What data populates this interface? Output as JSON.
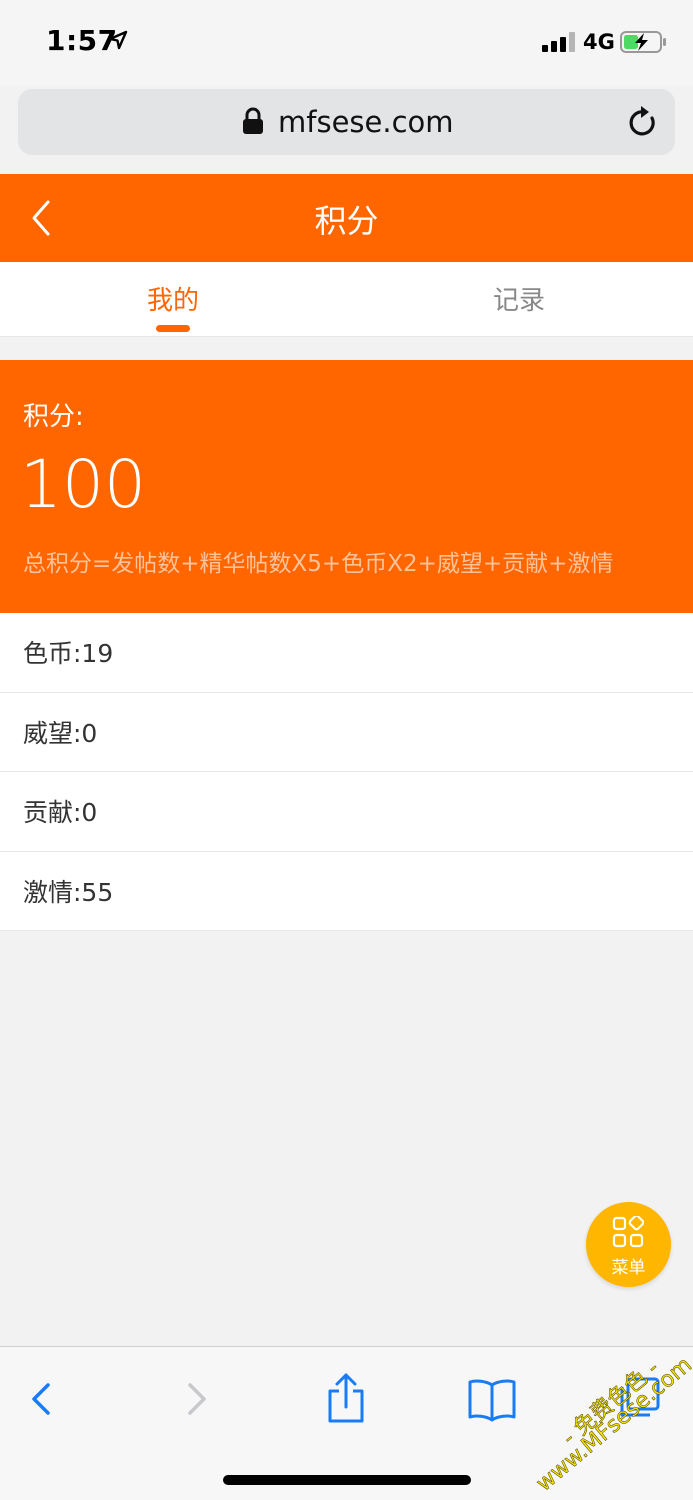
{
  "status_bar": {
    "time": "1:57",
    "network": "4G"
  },
  "browser": {
    "url": "mfsese.com"
  },
  "header": {
    "title": "积分"
  },
  "tabs": [
    {
      "label": "我的",
      "active": true
    },
    {
      "label": "记录",
      "active": false
    }
  ],
  "points": {
    "label": "积分:",
    "value": "100",
    "formula": "总积分=发帖数+精华帖数X5+色币X2+威望+贡献+激情"
  },
  "stats": [
    {
      "text": "色币:19"
    },
    {
      "text": "威望:0"
    },
    {
      "text": "贡献:0"
    },
    {
      "text": "激情:55"
    }
  ],
  "fab": {
    "label": "菜单"
  },
  "watermark": {
    "line1": "- 免费色色 -",
    "line2": "www.MFsese.com"
  },
  "colors": {
    "brand": "#ff6600",
    "fab": "#ffb600",
    "ios_blue": "#1a7cf5"
  }
}
